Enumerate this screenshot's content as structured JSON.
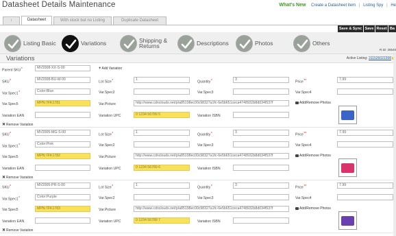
{
  "header": {
    "title": "Datasheet Details Maintenance",
    "whats_new": "What's New",
    "links": [
      "Create a Datasheet item",
      "Listing Spy",
      "He"
    ]
  },
  "tabs": [
    {
      "label": "↕",
      "active": false
    },
    {
      "label": "Datasheet",
      "active": true
    },
    {
      "label": "With stock but no Listing",
      "active": false
    },
    {
      "label": "Duplicate Datasheet",
      "active": false
    }
  ],
  "actions": [
    "Save & Sync",
    "Save",
    "Reset",
    "Ba"
  ],
  "steps": [
    {
      "label": "Listing Basic",
      "icon": "check-icon",
      "current": false
    },
    {
      "label": "Variations",
      "icon": "check-icon",
      "current": true
    },
    {
      "label_line1": "Shipping &",
      "label_line2": "Returns",
      "icon": "check-icon",
      "current": false
    },
    {
      "label": "Descriptions",
      "icon": "check-icon",
      "current": false
    },
    {
      "label": "Photos",
      "icon": "check-icon",
      "current": false
    },
    {
      "label": "Others",
      "icon": "check-icon",
      "current": false
    }
  ],
  "rid": "R.ID: 28546",
  "section": {
    "title": "Variations",
    "active_listing_label": "Active Listing:",
    "active_listing_value": "311526022398"
  },
  "parent": {
    "label": "Parent SKU",
    "value": "MV2008-XX-S-00",
    "add_variation": "Add Variation"
  },
  "labels": {
    "sku": "SKU",
    "lot_size": "Lot Size",
    "quantity": "Quantity",
    "price": "Price",
    "var_spec1": "Var.Spec1",
    "var_spec2": "Var.Spec2",
    "var_spec3": "Var.Spec3",
    "var_spec4": "Var.Spec4",
    "var_spec5": "Var.Spec5",
    "var_picture": "Var.Picture",
    "add_remove_photos": "Add/Remove Photos",
    "variation_ean": "Variation EAN",
    "variation_upc": "Variation UPC",
    "variation_isbn": "Variation ISBN",
    "remove_variation": "Remove Variation"
  },
  "variations": [
    {
      "sku": "MV2008-BU-M-00",
      "lot_size": "1",
      "quantity": "3",
      "price": "7.99",
      "spec1": "Color:Blue",
      "spec5": "MPN:7FK1781",
      "picture": "http://www.cdnclouds.net/p/a85198ec00c98327a1fc-6e5b651ceca4748932b8d034f537f",
      "upc": "0 1234 56789 5",
      "thumb_color": "#3b64c9"
    },
    {
      "sku": "MV2005-MG-S-00",
      "lot_size": "1",
      "quantity": "3",
      "price": "7.99",
      "spec1": "Color:Pink",
      "spec5": "MPN:7FK1782",
      "picture": "http://www.cdnclouds.net/p/a85198ec00c98327a1fc-6e5b651ceca4748932b8d034f537f",
      "upc": "0 1234 56789 6",
      "thumb_color": "#d8336b"
    },
    {
      "sku": "MV2005-PR-S-00",
      "lot_size": "1",
      "quantity": "3",
      "price": "7.99",
      "spec1": "Color:Purple",
      "spec5": "MPN:7FK1783",
      "picture": "http://www.cdnclouds.net/p/a85198ec00c98327a1fc-6e5b651ceca4748932b8d034f537f",
      "upc": "0 1234 56789 7",
      "thumb_color": "#6a3fb0"
    }
  ]
}
